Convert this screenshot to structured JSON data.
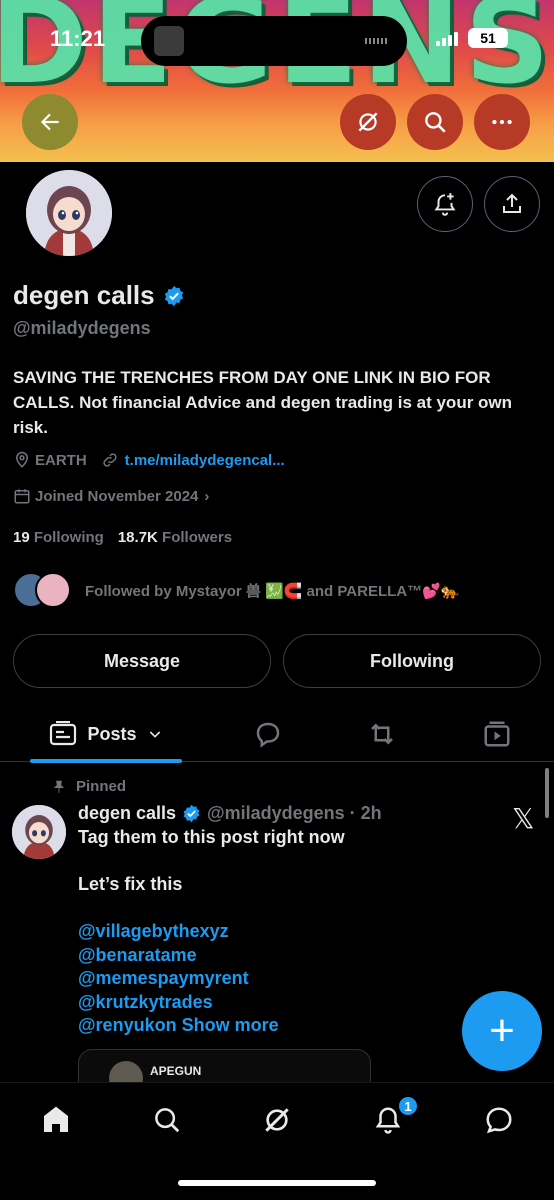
{
  "status_bar": {
    "time": "11:21",
    "battery": "51"
  },
  "banner": {
    "text": "DEGENS"
  },
  "header": {
    "back_icon": "arrow-left-icon",
    "grok_icon": "grok-icon",
    "search_icon": "search-icon",
    "more_icon": "more-horizontal-icon"
  },
  "profile": {
    "display_name": "degen calls",
    "verified": true,
    "handle": "@miladydegens",
    "bio": "SAVING THE TRENCHES FROM DAY ONE LINK IN BIO FOR CALLS. Not financial Advice and degen trading is at your own risk.",
    "location": "EARTH",
    "link": "t.me/miladydegencal...",
    "joined": "Joined November 2024",
    "following_count": "19",
    "following_label": "Following",
    "followers_count": "18.7K",
    "followers_label": "Followers",
    "followed_by": "Followed by Mystayor 兽 💹🧲 and PARELLA™💕🐅"
  },
  "actions": {
    "message": "Message",
    "following": "Following"
  },
  "tabs": {
    "posts": "Posts"
  },
  "post": {
    "pinned_label": "Pinned",
    "author": "degen calls",
    "handle_time": "@miladydegens · 2h",
    "line1": "Tag them to this post right now",
    "line2": "Let’s fix this",
    "mentions": [
      "@villagebythexyz",
      "@benaratame",
      "@memespaymyrent",
      "@krutzkytrades"
    ],
    "last_mention": "@renyukon",
    "show_more": "Show more",
    "embed_name": "APEGUN"
  },
  "fab": {
    "label": "+"
  },
  "bottom_nav": {
    "notification_badge": "1"
  },
  "colors": {
    "accent": "#1d9bf0",
    "background": "#000000",
    "muted": "#71767b"
  }
}
